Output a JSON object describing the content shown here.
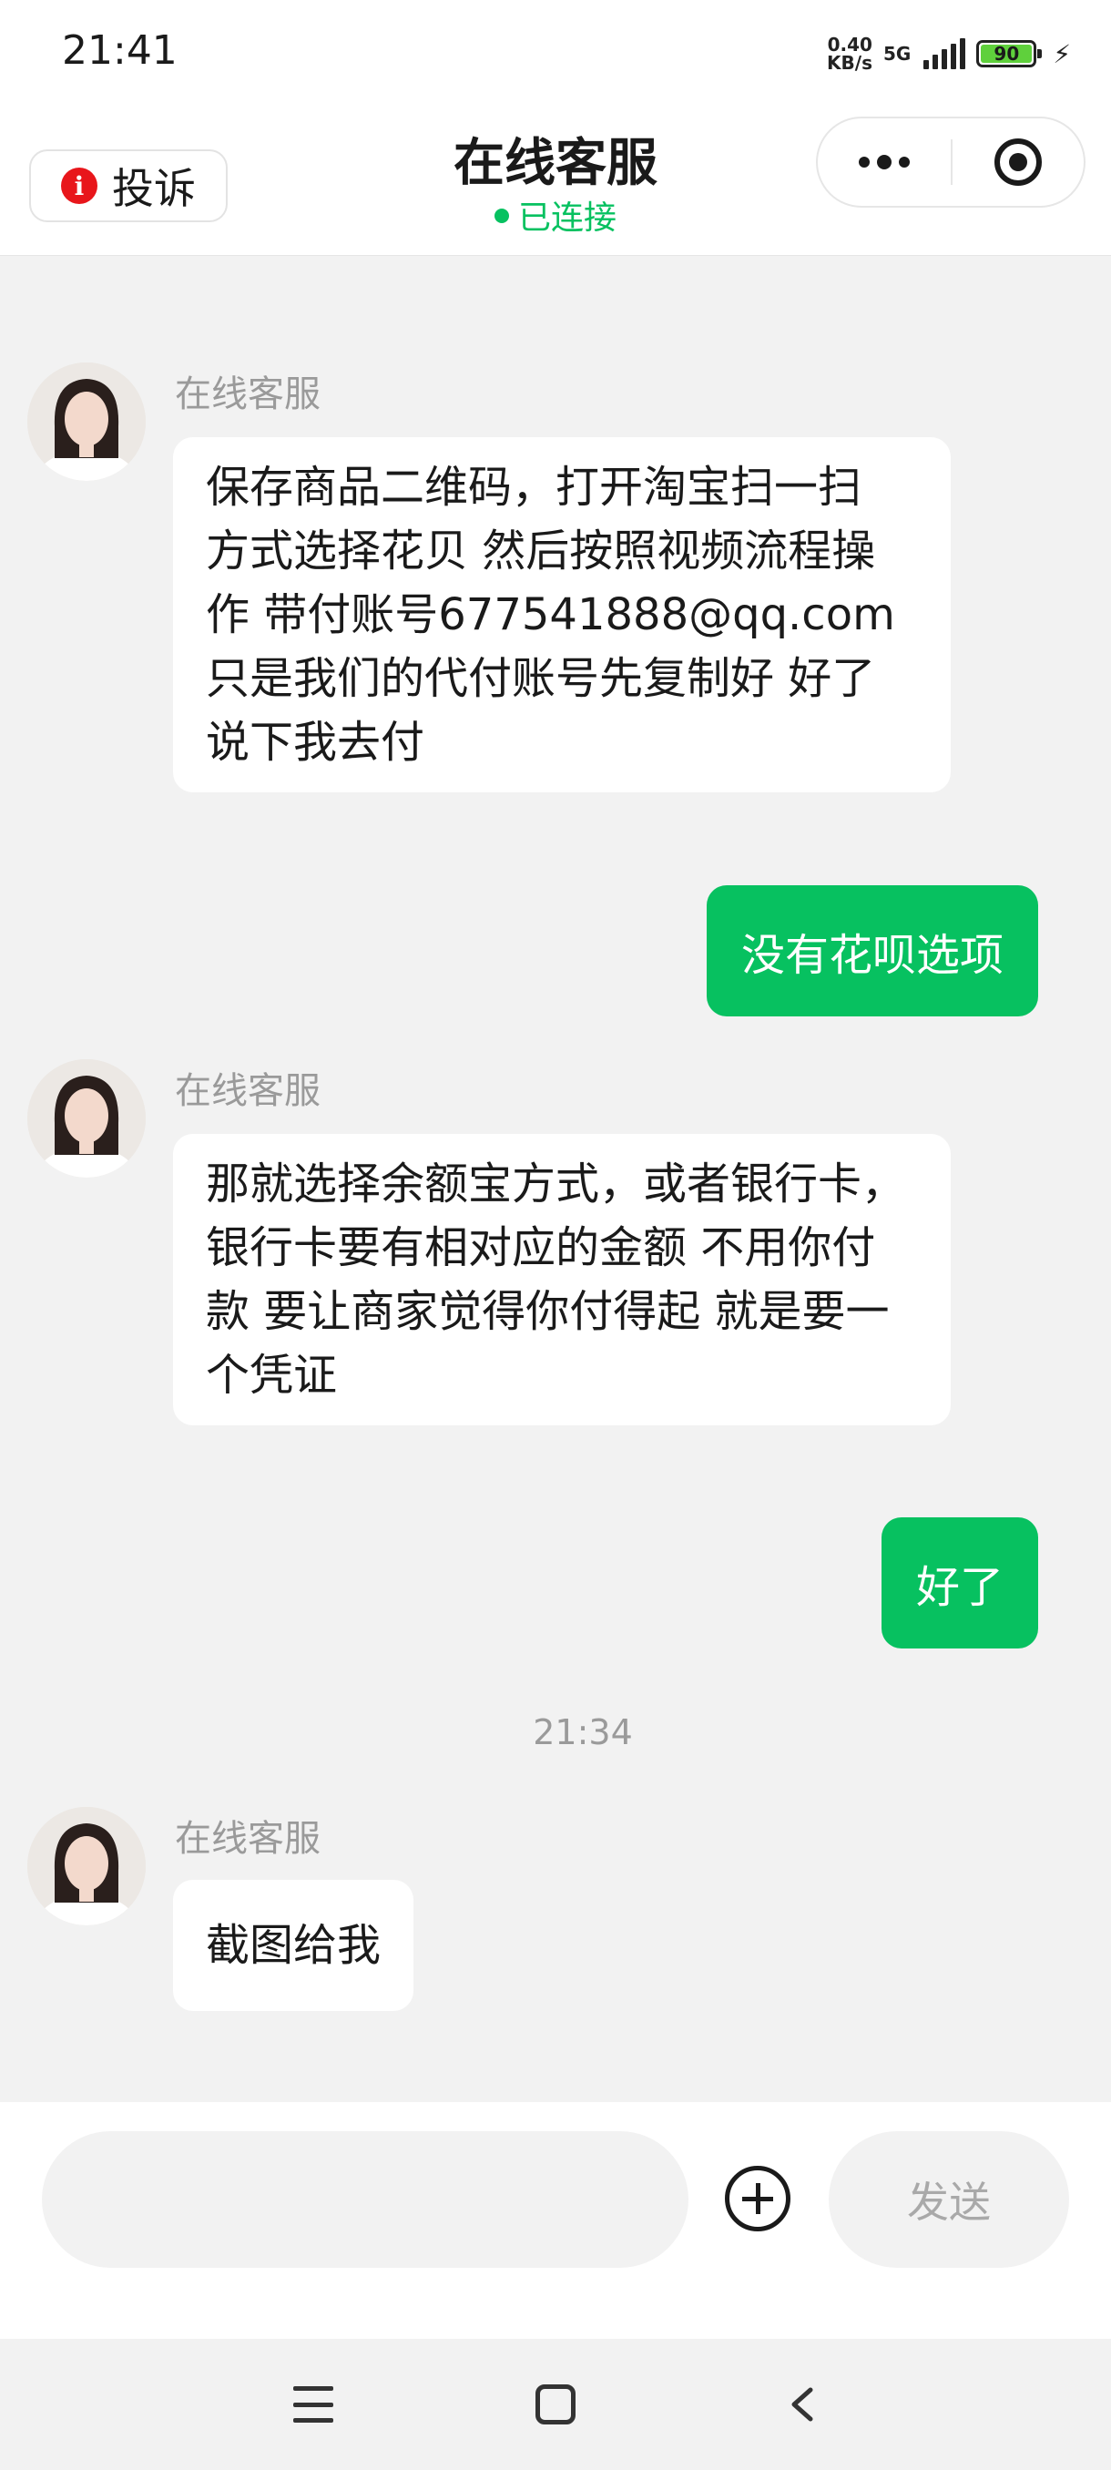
{
  "status_bar": {
    "time": "21:41",
    "net_speed_value": "0.40",
    "net_speed_unit": "KB/s",
    "network": "5G",
    "battery": "90"
  },
  "header": {
    "complain_label": "投诉",
    "title": "在线客服",
    "connection_status": "已连接"
  },
  "messages": [
    {
      "sender": "在线客服",
      "text": "保存商品二维码，打开淘宝扫一扫 方式选择花贝 然后按照视频流程操作 带付账号677541888@qq.com 只是我们的代付账号先复制好 好了说下我去付"
    },
    {
      "text": "没有花呗选项"
    },
    {
      "sender": "在线客服",
      "text": "那就选择余额宝方式，或者银行卡，银行卡要有相对应的金额 不用你付款 要让商家觉得你付得起 就是要一个凭证"
    },
    {
      "text": "好了"
    },
    {
      "timestamp": "21:34"
    },
    {
      "sender": "在线客服",
      "text": "截图给我"
    }
  ],
  "input_bar": {
    "placeholder": "",
    "send_label": "发送"
  },
  "colors": {
    "accent_green": "#07c160",
    "complain_red": "#e8161b",
    "background": "#f2f2f2"
  }
}
